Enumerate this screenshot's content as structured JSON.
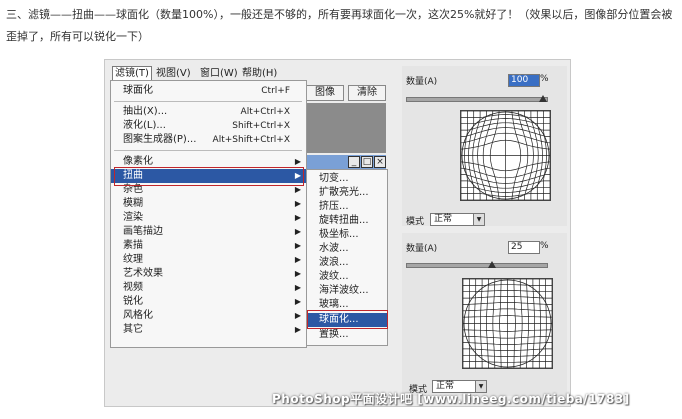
{
  "intro": "三、滤镜——扭曲——球面化（数量100%），一般还是不够的，所有要再球面化一次，这次25%就好了！（效果以后，图像部分位置会被歪掉了，所有可以锐化一下）",
  "menubar": {
    "filter": "滤镜(T)",
    "view": "视图(V)",
    "window": "窗口(W)",
    "help": "帮助(H)"
  },
  "toolbar": {
    "btn1": "图像",
    "btn2": "清除"
  },
  "window_buttons": {
    "min": "_",
    "max": "□",
    "close": "×"
  },
  "filter_menu": {
    "top_items": [
      {
        "label": "球面化",
        "shortcut": "Ctrl+F"
      },
      {
        "label": "抽出(X)...",
        "shortcut": "Alt+Ctrl+X"
      },
      {
        "label": "液化(L)...",
        "shortcut": "Shift+Ctrl+X"
      },
      {
        "label": "图案生成器(P)...",
        "shortcut": "Alt+Shift+Ctrl+X"
      }
    ],
    "categories": [
      "像素化",
      "扭曲",
      "杂色",
      "模糊",
      "渲染",
      "画笔描边",
      "素描",
      "纹理",
      "艺术效果",
      "视频",
      "锐化",
      "风格化",
      "其它"
    ]
  },
  "distort_submenu": [
    "切变...",
    "扩散亮光...",
    "挤压...",
    "旋转扭曲...",
    "极坐标...",
    "水波...",
    "波浪...",
    "波纹...",
    "海洋波纹...",
    "玻璃...",
    "球面化...",
    "置换..."
  ],
  "dialog1": {
    "amount_label": "数量(A)",
    "amount_value": "100",
    "unit": "%",
    "mode_label": "模式",
    "mode_value": "正常",
    "amount_fraction": 1.0
  },
  "dialog2": {
    "amount_label": "数量(A)",
    "amount_value": "25",
    "unit": "%",
    "mode_label": "模式",
    "mode_value": "正常",
    "amount_fraction": 0.5625
  },
  "watermark": "PhotoShop平面设计吧 [www.lineeg.com/tieba/1783]",
  "colors": {
    "highlight": "#2c58a4",
    "red_frame": "#c0262b"
  }
}
